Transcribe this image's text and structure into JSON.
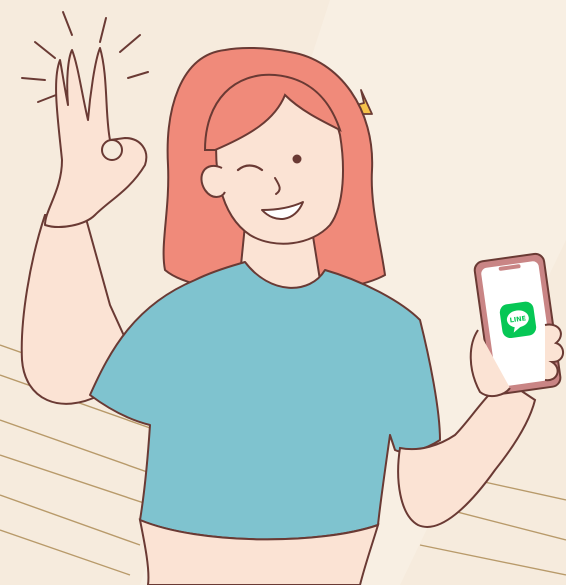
{
  "illustration": {
    "background": "#F6EBDD",
    "outline_color": "#6A3A34",
    "skin_color": "#FBE3D4",
    "hair_color": "#F08A7A",
    "shirt_color": "#7FC3CF",
    "stripe_color": "#B89A6A",
    "spark_color": "#F6C24A"
  },
  "phone": {
    "frame_color": "#C98585",
    "screen_color": "#FFFFFF",
    "app_icon": {
      "name": "line-app-icon",
      "label": "LINE",
      "color": "#06C755"
    }
  }
}
